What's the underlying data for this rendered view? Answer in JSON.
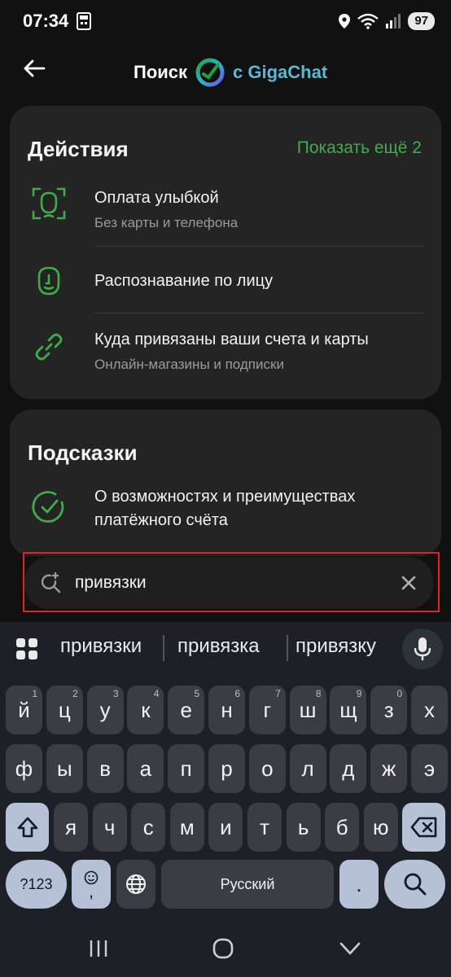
{
  "status_bar": {
    "time": "07:34",
    "battery": "97"
  },
  "header": {
    "back_label": "back",
    "title_part1": "Поиск",
    "title_part2": "с GigaChat"
  },
  "actions_card": {
    "title": "Действия",
    "show_more": "Показать ещё 2",
    "items": [
      {
        "title": "Оплата улыбкой",
        "subtitle": "Без карты и телефона",
        "icon": "face-scan-icon"
      },
      {
        "title": "Распознавание по лицу",
        "subtitle": "",
        "icon": "face-id-icon"
      },
      {
        "title": "Куда привязаны ваши счета и карты",
        "subtitle": "Онлайн-магазины и подписки",
        "icon": "link-icon"
      }
    ]
  },
  "hints_card": {
    "title": "Подсказки",
    "items": [
      {
        "title_line1": "О возможностях и преимуществах",
        "title_line2": "платёжного счёта",
        "icon": "check-circle-icon"
      }
    ]
  },
  "search": {
    "value": "привязки"
  },
  "keyboard": {
    "suggestions": [
      "привязки",
      "привязка",
      "привязку"
    ],
    "row1": [
      {
        "k": "й",
        "h": "1"
      },
      {
        "k": "ц",
        "h": "2"
      },
      {
        "k": "у",
        "h": "3"
      },
      {
        "k": "к",
        "h": "4"
      },
      {
        "k": "е",
        "h": "5"
      },
      {
        "k": "н",
        "h": "6"
      },
      {
        "k": "г",
        "h": "7"
      },
      {
        "k": "ш",
        "h": "8"
      },
      {
        "k": "щ",
        "h": "9"
      },
      {
        "k": "з",
        "h": "0"
      },
      {
        "k": "х",
        "h": ""
      }
    ],
    "row2": [
      "ф",
      "ы",
      "в",
      "а",
      "п",
      "р",
      "о",
      "л",
      "д",
      "ж",
      "э"
    ],
    "row3": [
      "я",
      "ч",
      "с",
      "м",
      "и",
      "т",
      "ь",
      "б",
      "ю"
    ],
    "num_key": "?123",
    "comma_key": ",",
    "space_label": "Русский",
    "period_key": "."
  },
  "colors": {
    "accent_green": "#3fae49",
    "giga_blue": "#57b9d6",
    "highlight_red": "#e0242a"
  }
}
